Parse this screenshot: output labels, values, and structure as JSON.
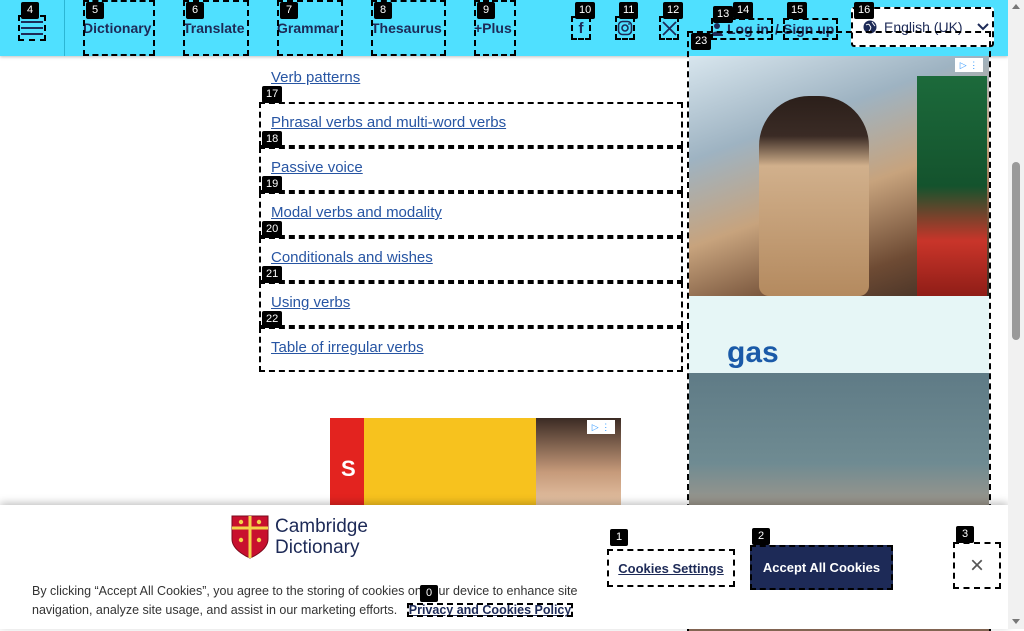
{
  "header": {
    "nav": {
      "dictionary": "Dictionary",
      "translate": "Translate",
      "grammar": "Grammar",
      "thesaurus": "Thesaurus",
      "plus": "+Plus"
    },
    "auth": {
      "login": "Log in",
      "separator": "/",
      "signup": "Sign up"
    },
    "language": "English (UK)",
    "icons": {
      "menu": "hamburger-menu-icon",
      "facebook": "facebook-icon",
      "instagram": "instagram-icon",
      "x": "x-twitter-icon",
      "globe": "globe-icon",
      "chevron": "chevron-down-icon",
      "user": "user-icon"
    }
  },
  "grammar_links": [
    "Verb patterns",
    "Phrasal verbs and multi-word verbs",
    "Passive voice",
    "Modal verbs and modality",
    "Conditionals and wishes",
    "Using verbs",
    "Table of irregular verbs"
  ],
  "ads": {
    "side_word": "gas"
  },
  "cookie": {
    "logo_line1": "Cambridge",
    "logo_line2": "Dictionary",
    "text": "By clicking “Accept All Cookies”, you agree to the storing of cookies on your device to enhance site navigation, analyze site usage, and assist in our marketing efforts.",
    "policy_link": "Privacy and Cookies Policy",
    "settings_button": "Cookies Settings",
    "accept_button": "Accept All Cookies",
    "close_symbol": "×"
  },
  "badges": [
    "0",
    "1",
    "2",
    "3",
    "4",
    "5",
    "6",
    "7",
    "8",
    "9",
    "10",
    "11",
    "12",
    "13",
    "14",
    "15",
    "16",
    "17",
    "18",
    "19",
    "20",
    "21",
    "22",
    "23"
  ],
  "colors": {
    "header_bg": "#4fe0ff",
    "navy": "#1d2a57",
    "link": "#2755a3"
  }
}
